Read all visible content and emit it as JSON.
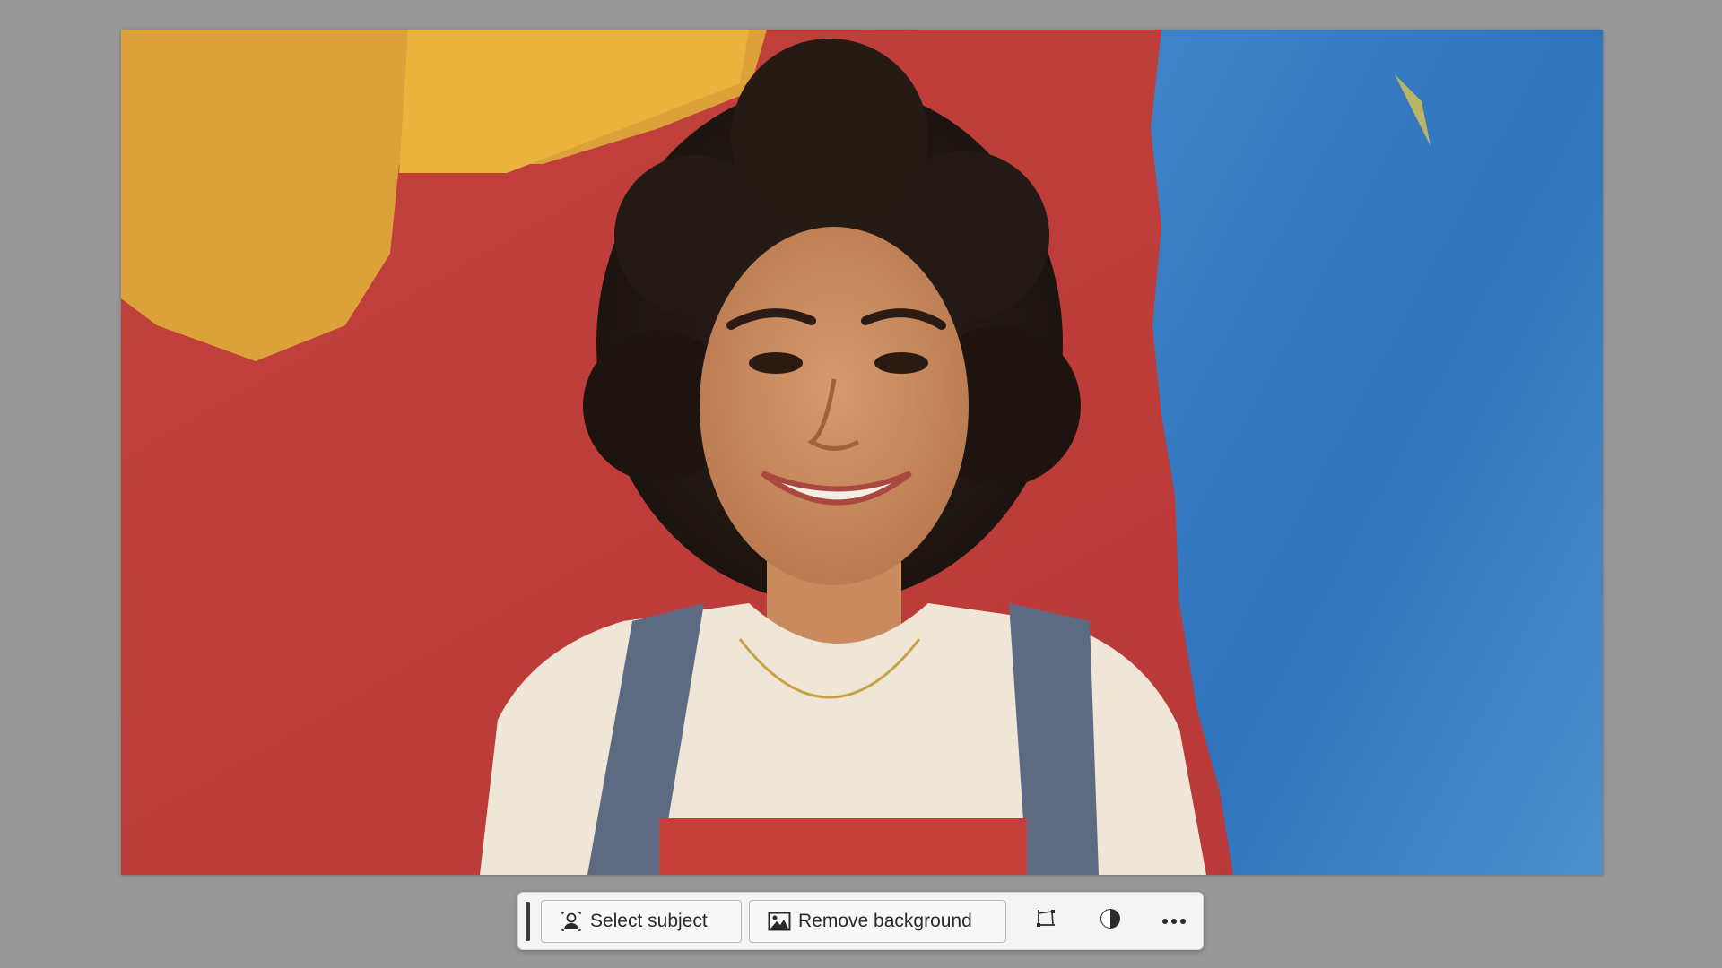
{
  "canvas": {
    "image_description_icon": "photo-canvas"
  },
  "taskbar": {
    "select_subject_label": "Select subject",
    "remove_background_label": "Remove background",
    "icons": [
      "person-select-icon",
      "image-icon",
      "crop-icon",
      "adjust-contrast-icon",
      "more-options-icon"
    ]
  },
  "colors": {
    "workspace_bg": "#979797",
    "taskbar_bg": "#f4f4f4"
  }
}
